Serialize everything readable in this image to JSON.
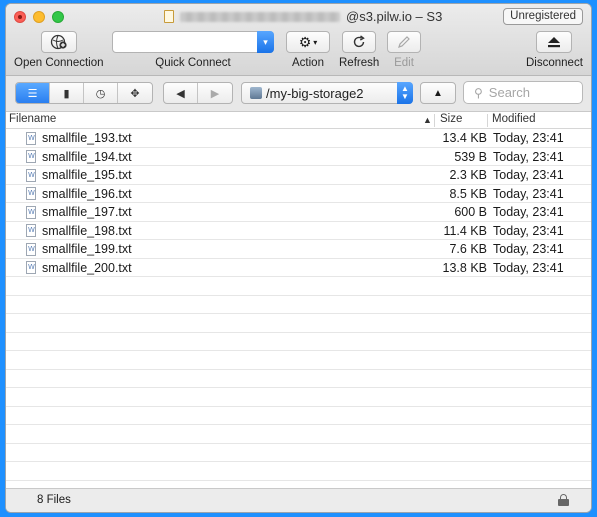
{
  "window": {
    "title_suffix": "@s3.pilw.io – S3",
    "unregistered": "Unregistered"
  },
  "toolbar": {
    "open_connection": "Open Connection",
    "quick_connect": "Quick Connect",
    "quick_connect_value": "",
    "action": "Action",
    "refresh": "Refresh",
    "edit": "Edit",
    "disconnect": "Disconnect"
  },
  "navbar": {
    "path": "/my-big-storage2",
    "search_placeholder": "Search",
    "view_tabs": [
      "browser",
      "bookmarks",
      "history",
      "bonjour"
    ],
    "active_tab": "browser"
  },
  "table": {
    "headers": {
      "filename": "Filename",
      "size": "Size",
      "modified": "Modified"
    },
    "rows": [
      {
        "name": "smallfile_193.txt",
        "size": "13.4 KB",
        "modified": "Today, 23:41"
      },
      {
        "name": "smallfile_194.txt",
        "size": "539 B",
        "modified": "Today, 23:41"
      },
      {
        "name": "smallfile_195.txt",
        "size": "2.3 KB",
        "modified": "Today, 23:41"
      },
      {
        "name": "smallfile_196.txt",
        "size": "8.5 KB",
        "modified": "Today, 23:41"
      },
      {
        "name": "smallfile_197.txt",
        "size": "600 B",
        "modified": "Today, 23:41"
      },
      {
        "name": "smallfile_198.txt",
        "size": "11.4 KB",
        "modified": "Today, 23:41"
      },
      {
        "name": "smallfile_199.txt",
        "size": "7.6 KB",
        "modified": "Today, 23:41"
      },
      {
        "name": "smallfile_200.txt",
        "size": "13.8 KB",
        "modified": "Today, 23:41"
      }
    ]
  },
  "status": {
    "file_count": "8 Files"
  },
  "colors": {
    "accent": "#2a7ff0",
    "frame": "#1e90ff"
  }
}
